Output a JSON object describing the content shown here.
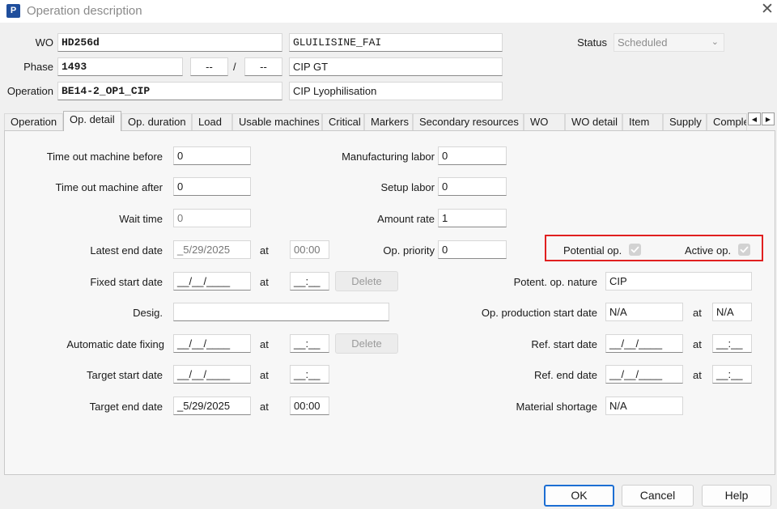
{
  "window": {
    "title": "Operation description",
    "app_icon_letter": "P"
  },
  "header": {
    "wo_label": "WO",
    "wo_value": "HD256d",
    "wo_desc": "GLUILISINE_FAI",
    "phase_label": "Phase",
    "phase_value": "1493",
    "phase_from": "--",
    "phase_sep": "/",
    "phase_to": "--",
    "phase_desc": "CIP GT",
    "operation_label": "Operation",
    "operation_value": "BE14-2_OP1_CIP",
    "operation_desc": "CIP Lyophilisation",
    "status_label": "Status",
    "status_value": "Scheduled"
  },
  "tabs": [
    "Operation",
    "Op. detail",
    "Op. duration",
    "Load",
    "Usable machines",
    "Critical",
    "Markers",
    "Secondary resources",
    "WO",
    "WO detail",
    "Item",
    "Supply",
    "Comple"
  ],
  "left": {
    "time_out_before_label": "Time out machine before",
    "time_out_before": "0",
    "time_out_after_label": "Time out machine after",
    "time_out_after": "0",
    "wait_time_label": "Wait time",
    "wait_time": "0",
    "latest_end_label": "Latest end date",
    "latest_end_date": "_5/29/2025",
    "latest_end_time": "00:00",
    "fixed_start_label": "Fixed start date",
    "fixed_start_date": "__/__/____",
    "fixed_start_time": "__:__",
    "desig_label": "Desig.",
    "desig_value": "",
    "auto_fix_label": "Automatic date fixing",
    "auto_fix_date": "__/__/____",
    "auto_fix_time": "__:__",
    "target_start_label": "Target start date",
    "target_start_date": "__/__/____",
    "target_start_time": "__:__",
    "target_end_label": "Target end date",
    "target_end_date": "_5/29/2025",
    "target_end_time": "00:00",
    "at_label": "at",
    "delete_label": "Delete"
  },
  "middle": {
    "mfg_labor_label": "Manufacturing labor",
    "mfg_labor": "0",
    "setup_labor_label": "Setup labor",
    "setup_labor": "0",
    "amount_rate_label": "Amount rate",
    "amount_rate": "1",
    "op_priority_label": "Op. priority",
    "op_priority": "0"
  },
  "right": {
    "potential_op_label": "Potential op.",
    "active_op_label": "Active op.",
    "potential_op_checked": true,
    "active_op_checked": true,
    "potent_nature_label": "Potent. op. nature",
    "potent_nature": "CIP",
    "op_prod_start_label": "Op. production start date",
    "op_prod_start": "N/A",
    "op_prod_start_time": "N/A",
    "ref_start_label": "Ref. start date",
    "ref_start_date": "__/__/____",
    "ref_start_time": "__:__",
    "ref_end_label": "Ref. end date",
    "ref_end_date": "__/__/____",
    "ref_end_time": "__:__",
    "material_shortage_label": "Material shortage",
    "material_shortage": "N/A",
    "at_label": "at"
  },
  "footer": {
    "ok": "OK",
    "cancel": "Cancel",
    "help": "Help"
  },
  "colors": {
    "highlight_box": "#e02020",
    "ok_border": "#1c6ed3",
    "app_icon": "#1f4e9c"
  },
  "icons": [
    "close-icon",
    "chevron-down-icon",
    "tab-scroll-left-icon",
    "tab-scroll-right-icon",
    "checkbox-checked-icon"
  ]
}
